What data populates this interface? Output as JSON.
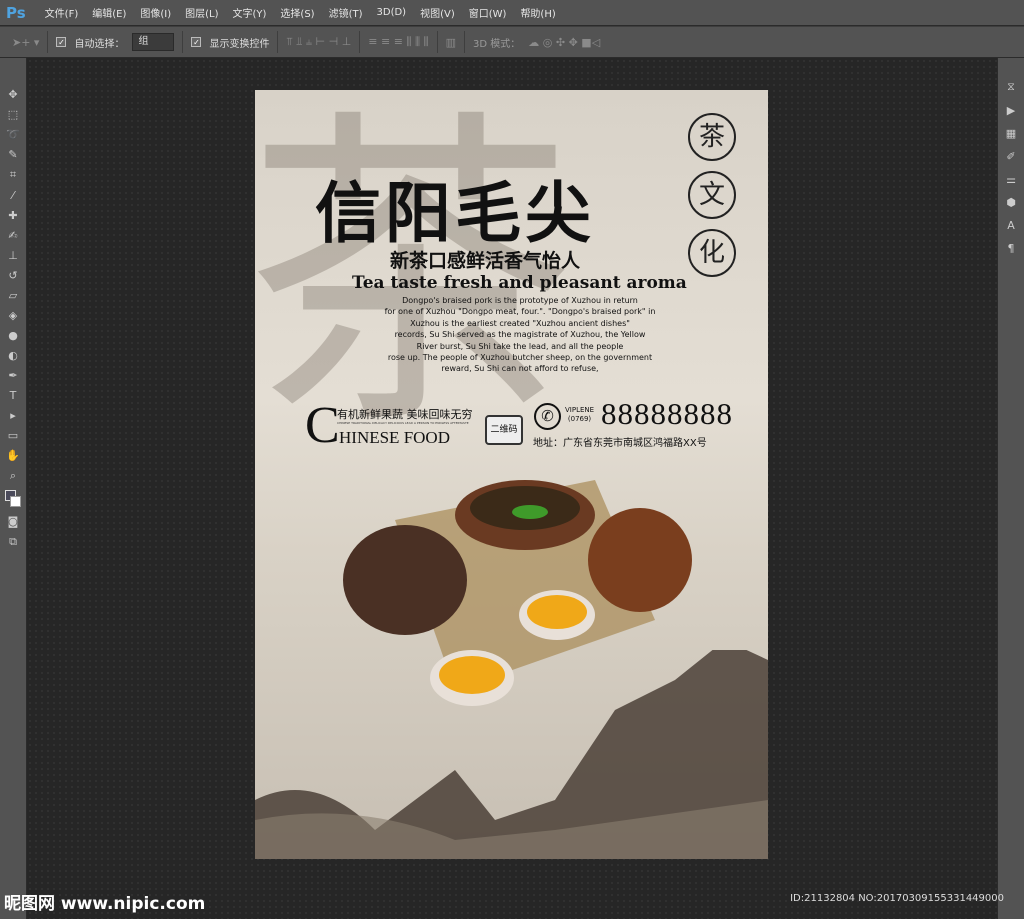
{
  "app": {
    "logo": "Ps"
  },
  "menu": [
    "文件(F)",
    "编辑(E)",
    "图像(I)",
    "图层(L)",
    "文字(Y)",
    "选择(S)",
    "滤镜(T)",
    "3D(D)",
    "视图(V)",
    "窗口(W)",
    "帮助(H)"
  ],
  "options": {
    "auto_select_label": "自动选择：",
    "auto_select_value": "组",
    "show_transform_label": "显示变换控件",
    "mode_3d_label": "3D 模式："
  },
  "poster": {
    "bg_char": "茶",
    "title": "信阳毛尖",
    "circles": [
      "茶",
      "文",
      "化"
    ],
    "subtitle_cn": "新茶口感鲜活香气怡人",
    "subtitle_en": "Tea taste fresh and pleasant aroma",
    "body_lines": [
      "Dongpo's braised pork is the prototype of Xuzhou in return",
      "for one of Xuzhou \"Dongpo meat, four.\". \"Dongpo's braised pork\" in",
      "Xuzhou is the earliest created \"Xuzhou ancient dishes\"",
      "records, Su Shi served as the magistrate of Xuzhou, the Yellow",
      "River burst, Su Shi take the lead, and all the people",
      "rose up. The people of Xuzhou butcher sheep, on the government",
      "reward, Su Shi can not afford to refuse,"
    ],
    "chinese_food": {
      "big_c": "C",
      "cn": "有机新鲜果蔬  美味回味无穷",
      "tiny": "CHINESE TRADITIONAL DELICACY DELICIOUS LEAD A PERSON TO ENDLESS AFTERTASTE",
      "en": "HINESE FOOD"
    },
    "qr_label": "二维码",
    "phone_label": "VIPLENE",
    "area_code": "(0769)",
    "phone": "88888888",
    "address": "地址：广东省东莞市南城区鸿福路XX号"
  },
  "watermark": "昵图网 www.nipic.com",
  "id_text": "ID:21132804 NO:20170309155331449000"
}
